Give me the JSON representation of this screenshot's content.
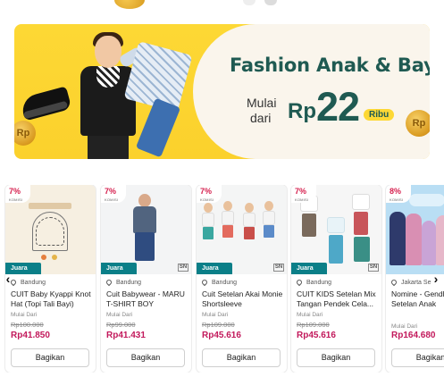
{
  "banner": {
    "title": "Fashion Anak & Bayi",
    "prefix_line1": "Mulai",
    "prefix_line2": "dari",
    "currency": "Rp",
    "amount": "22",
    "unit": "Ribu",
    "colors": {
      "yellow": "#fdd835",
      "teal": "#1f5a52",
      "cream": "#faf5ec"
    }
  },
  "carousel": {
    "prev_icon": "chevron-left-icon",
    "next_icon": "chevron-right-icon",
    "products": [
      {
        "komisi_pct": "7%",
        "komisi_label": "KOMISI",
        "badge": "Juara",
        "location": "Bandung",
        "name": "CUIT Baby Kyappi Knot Hat (Topi Tali Bayi)",
        "price_label": "Mulai Dari",
        "original_price": "Rp100.000",
        "price": "Rp41.850",
        "button": "Bagikan"
      },
      {
        "komisi_pct": "7%",
        "komisi_label": "KOMISI",
        "badge": "Juara",
        "location": "Bandung",
        "name": "Cuit Babywear - MARU T-SHIRT BOY",
        "price_label": "Mulai Dari",
        "original_price": "Rp99.000",
        "price": "Rp41.431",
        "button": "Bagikan",
        "seal": "SN"
      },
      {
        "komisi_pct": "7%",
        "komisi_label": "KOMISI",
        "badge": "Juara",
        "location": "Bandung",
        "name": "Cuit Setelan Akai Monie Shortsleeve",
        "price_label": "Mulai Dari",
        "original_price": "Rp109.000",
        "price": "Rp45.616",
        "button": "Bagikan",
        "seal": "SN"
      },
      {
        "komisi_pct": "7%",
        "komisi_label": "KOMISI",
        "badge": "Juara",
        "location": "Bandung",
        "name": "CUIT KIDS Setelan Mix Tangan Pendek Cela...",
        "price_label": "Mulai Dari",
        "original_price": "Rp109.000",
        "price": "Rp45.616",
        "button": "Bagikan",
        "seal": "SN"
      },
      {
        "komisi_pct": "8%",
        "komisi_label": "KOMISI",
        "location": "Jakarta Se",
        "name": "Nomine - Gendhis - Setelan Anak",
        "price_label": "Mulai Dari",
        "price": "Rp164.680",
        "button": "Bagikan"
      }
    ]
  }
}
